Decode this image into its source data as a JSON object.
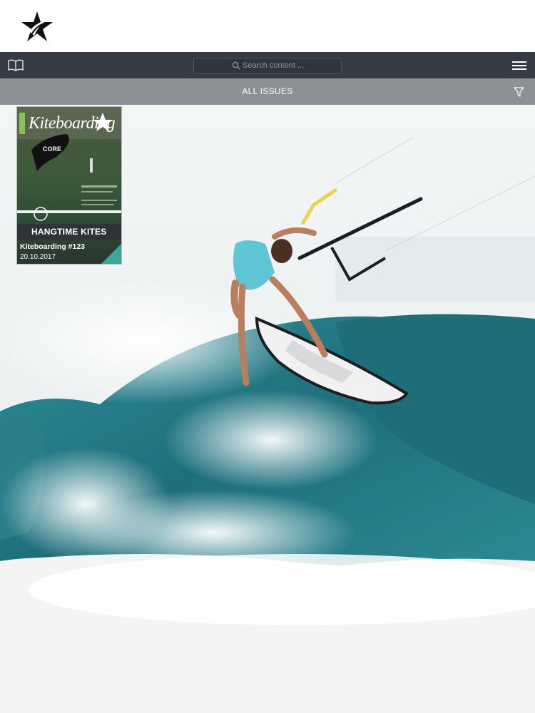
{
  "header": {
    "logo_icon": "star-logo-icon"
  },
  "toolbar": {
    "library_icon": "book-icon",
    "search_placeholder": "Search content ...",
    "search_icon": "search-icon",
    "menu_icon": "hamburger-menu-icon",
    "background": "#343b46"
  },
  "filterbar": {
    "title": "ALL ISSUES",
    "filter_icon": "filter-funnel-icon",
    "background": "#8d9196"
  },
  "hero": {
    "image": "kitesurfer riding ocean wave"
  },
  "issues": [
    {
      "masthead": "Kiteboarding",
      "cover_headline": "HANGTIME KITES",
      "title": "Kiteboarding #123",
      "date": "20.10.2017",
      "accent": "#3aa79a"
    }
  ]
}
